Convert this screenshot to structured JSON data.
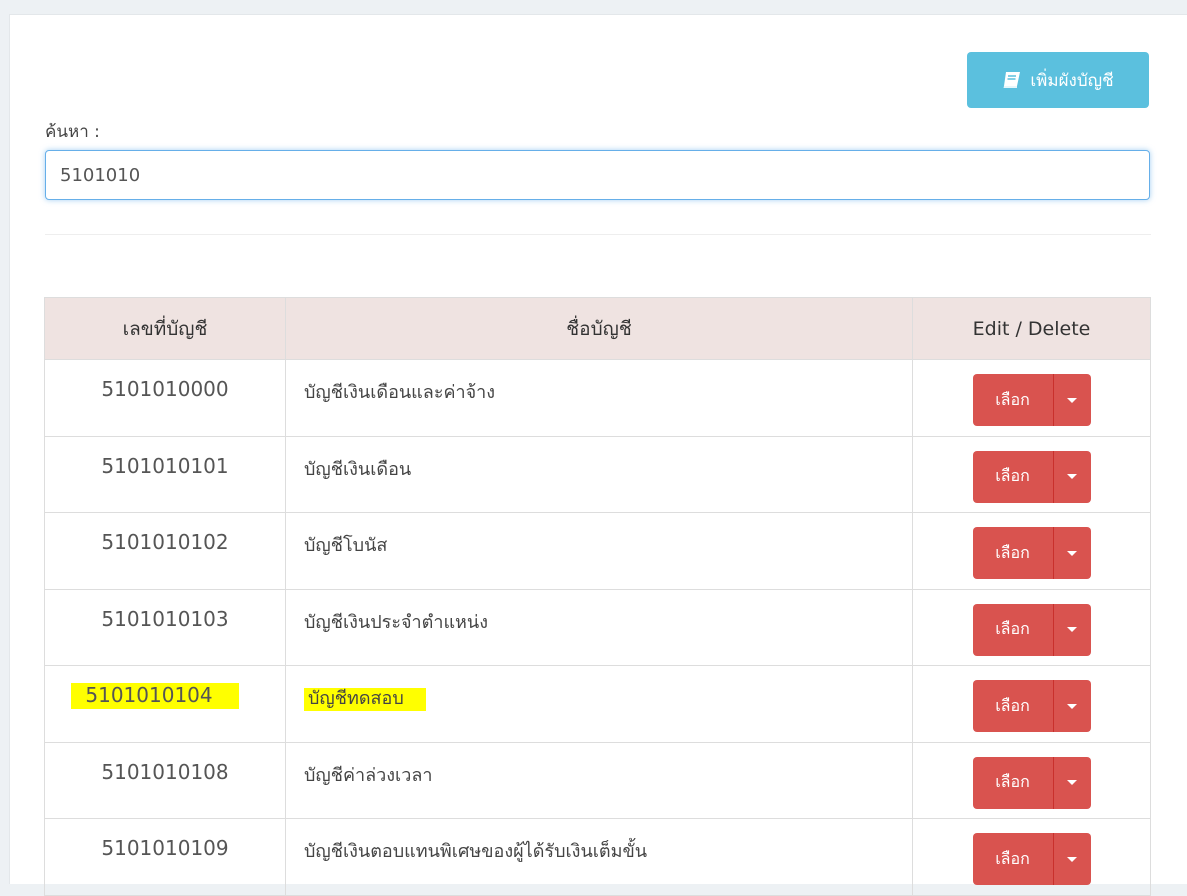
{
  "toolbar": {
    "add_label": "เพิ่มผังบัญชี",
    "add_icon": "book-icon"
  },
  "search": {
    "label": "ค้นหา :",
    "value": "5101010"
  },
  "table": {
    "headers": {
      "account_number": "เลขที่บัญชี",
      "account_name": "ชื่อบัญชี",
      "actions": "Edit / Delete"
    },
    "rows": [
      {
        "number": "5101010000",
        "name": "บัญชีเงินเดือนและค่าจ้าง",
        "action_label": "เลือก",
        "highlighted": false
      },
      {
        "number": "5101010101",
        "name": "บัญชีเงินเดือน",
        "action_label": "เลือก",
        "highlighted": false
      },
      {
        "number": "5101010102",
        "name": "บัญชีโบนัส",
        "action_label": "เลือก",
        "highlighted": false
      },
      {
        "number": "5101010103",
        "name": "บัญชีเงินประจำตำแหน่ง",
        "action_label": "เลือก",
        "highlighted": false
      },
      {
        "number": "5101010104",
        "name": "บัญชีทดสอบ",
        "action_label": "เลือก",
        "highlighted": true
      },
      {
        "number": "5101010108",
        "name": "บัญชีค่าล่วงเวลา",
        "action_label": "เลือก",
        "highlighted": false
      },
      {
        "number": "5101010109",
        "name": "บัญชีเงินตอบแทนพิเศษของผู้ได้รับเงินเต็มขั้น",
        "action_label": "เลือก",
        "highlighted": false
      }
    ]
  },
  "colors": {
    "info_button": "#5bc0de",
    "danger_button": "#d9534f",
    "table_header_bg": "#efe3e1",
    "highlight": "#ffff00",
    "input_focus_border": "#66afe9"
  }
}
